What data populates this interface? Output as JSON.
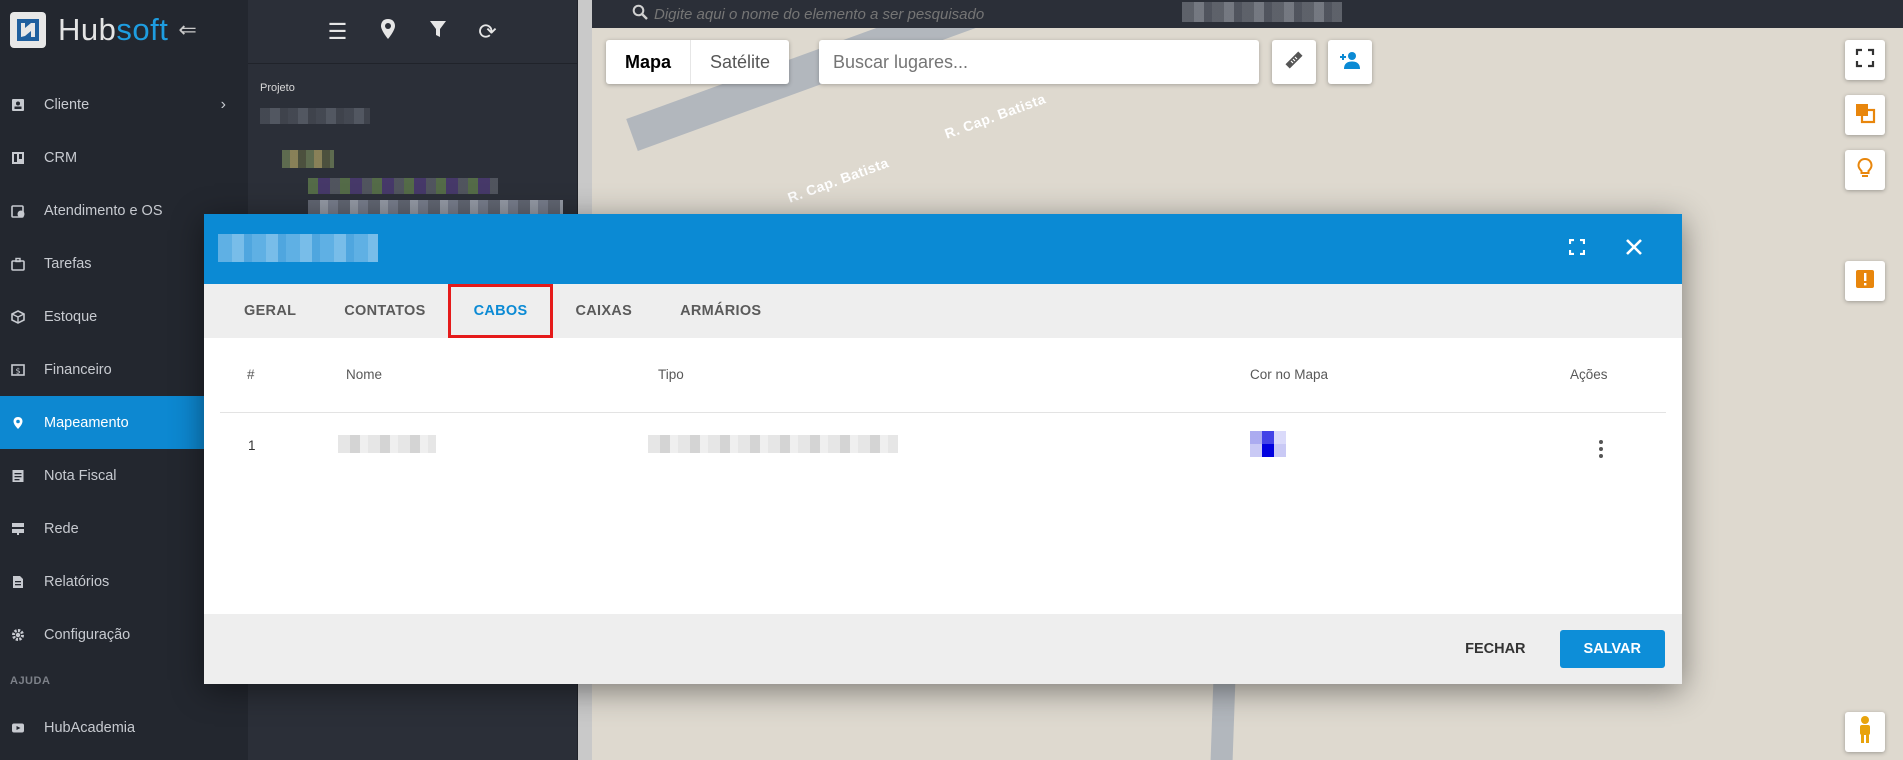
{
  "brand": {
    "hub": "Hub",
    "soft": "soft"
  },
  "sidebar": {
    "items": [
      {
        "label": "Cliente",
        "icon": "id-card-icon",
        "chevron": true
      },
      {
        "label": "CRM",
        "icon": "board-icon"
      },
      {
        "label": "Atendimento e OS",
        "icon": "calendar-clock-icon"
      },
      {
        "label": "Tarefas",
        "icon": "briefcase-icon"
      },
      {
        "label": "Estoque",
        "icon": "box-icon"
      },
      {
        "label": "Financeiro",
        "icon": "money-icon"
      },
      {
        "label": "Mapeamento",
        "icon": "map-pin-icon",
        "active": true
      },
      {
        "label": "Nota Fiscal",
        "icon": "document-icon"
      },
      {
        "label": "Rede",
        "icon": "server-icon"
      },
      {
        "label": "Relatórios",
        "icon": "report-icon"
      },
      {
        "label": "Configuração",
        "icon": "gear-icon"
      }
    ],
    "section_label": "AJUDA",
    "help_items": [
      {
        "label": "HubAcademia",
        "icon": "play-icon"
      }
    ]
  },
  "panel": {
    "projeto_label": "Projeto"
  },
  "map": {
    "top_search_placeholder": "Digite aqui o nome do elemento a ser pesquisado",
    "map_type": {
      "map": "Mapa",
      "satellite": "Satélite"
    },
    "places_placeholder": "Buscar lugares...",
    "road_label": "R. Cap. Batista",
    "road_label_partial": "Batista"
  },
  "modal": {
    "tabs": [
      "GERAL",
      "CONTATOS",
      "CABOS",
      "CAIXAS",
      "ARMÁRIOS"
    ],
    "active_tab": "CABOS",
    "table": {
      "headers": {
        "num": "#",
        "nome": "Nome",
        "tipo": "Tipo",
        "cor": "Cor no Mapa",
        "acoes": "Ações"
      },
      "rows": [
        {
          "num": "1"
        }
      ]
    },
    "footer": {
      "close": "FECHAR",
      "save": "SALVAR"
    }
  },
  "colors": {
    "accent": "#0b8ad4",
    "sidebar_bg": "#23272f",
    "active_nav": "#0d88d1",
    "highlight": "#e51a1a",
    "orange": "#e8860c"
  }
}
